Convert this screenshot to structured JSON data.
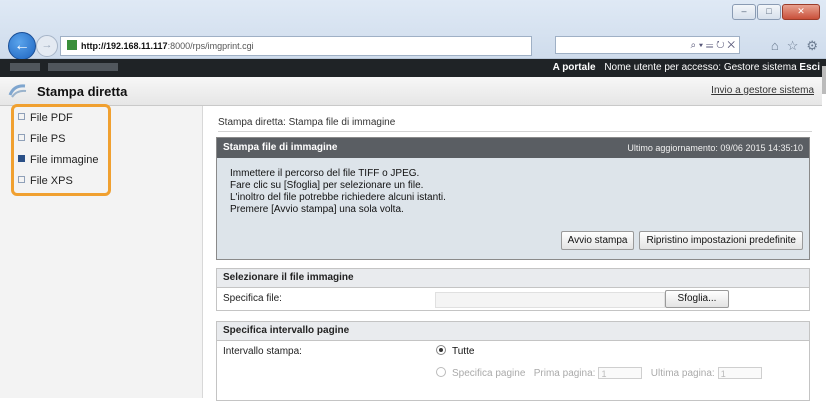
{
  "browser": {
    "url_host": "http://192.168.11.117",
    "url_rest": ":8000/rps/imgprint.cgi",
    "address_tools": "⌕ ▾ ☰ ↻ ✕",
    "window_buttons": [
      "–",
      "□",
      "✕"
    ]
  },
  "header": {
    "portal_link": "A portale",
    "user_label": "Nome utente per accesso:",
    "user_name": "Gestore sistema",
    "logout": "Esci"
  },
  "titlebar": {
    "title": "Stampa diretta",
    "back_link": "Invio a gestore sistema"
  },
  "sidebar": {
    "items": [
      {
        "label": "File PDF",
        "active": false
      },
      {
        "label": "File PS",
        "active": false
      },
      {
        "label": "File immagine",
        "active": true
      },
      {
        "label": "File XPS",
        "active": false
      }
    ]
  },
  "breadcrumb": "Stampa diretta: Stampa file di immagine",
  "panel": {
    "title": "Stampa file di immagine",
    "last_update": "Ultimo aggiornamento: 09/06 2015 14:35:10",
    "instructions": [
      "Immettere il percorso del file TIFF o JPEG.",
      "Fare clic su [Sfoglia] per selezionare un file.",
      "L'inoltro del file potrebbe richiedere alcuni istanti.",
      "Premere [Avvio stampa] una sola volta."
    ],
    "print_button": "Avvio stampa",
    "reset_button": "Ripristino impostazioni predefinite"
  },
  "file_section": {
    "title": "Selezionare il file immagine",
    "label": "Specifica file:",
    "browse_button": "Sfoglia..."
  },
  "range_section": {
    "title": "Specifica intervallo pagine",
    "label": "Intervallo stampa:",
    "option_all": "Tutte",
    "option_specify": "Specifica pagine",
    "first_page_label": "Prima pagina:",
    "first_page_value": "1",
    "last_page_label": "Ultima pagina:",
    "last_page_value": "1"
  }
}
